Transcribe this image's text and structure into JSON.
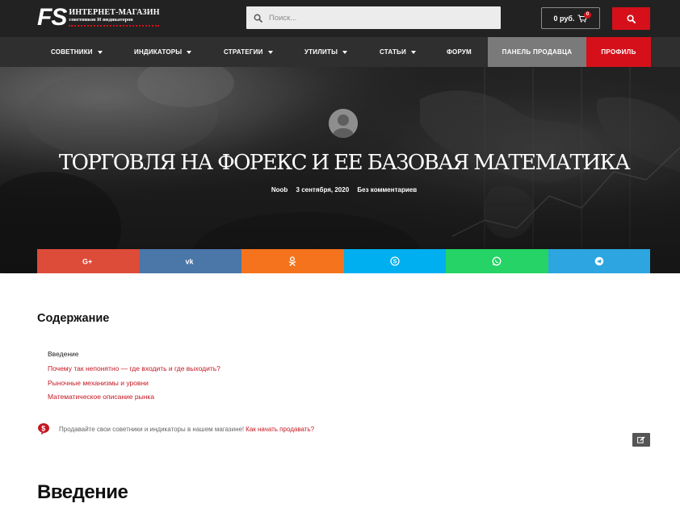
{
  "header": {
    "logo_mark": "FS",
    "logo_line1": "ИНТЕРНЕТ-МАГАЗИН",
    "logo_line2": "советников И индикаторов",
    "search_placeholder": "Поиск...",
    "cart_amount": "0 руб.",
    "cart_count": "0"
  },
  "nav": {
    "items": [
      {
        "label": "СОВЕТНИКИ",
        "dropdown": true
      },
      {
        "label": "ИНДИКАТОРЫ",
        "dropdown": true
      },
      {
        "label": "СТРАТЕГИИ",
        "dropdown": true
      },
      {
        "label": "УТИЛИТЫ",
        "dropdown": true
      },
      {
        "label": "СТАТЬИ",
        "dropdown": true
      },
      {
        "label": "ФОРУМ",
        "dropdown": false
      }
    ],
    "seller_panel": "ПАНЕЛЬ ПРОДАВЦА",
    "profile": "ПРОФИЛЬ"
  },
  "hero": {
    "title": "ТОРГОВЛЯ НА ФОРЕКС И ЕЕ БАЗОВАЯ МАТЕМАТИКА",
    "author": "Noob",
    "date": "3 сентября, 2020",
    "comments": "Без комментариев"
  },
  "share": [
    {
      "network": "google-plus",
      "color": "#dd4b39",
      "glyph": "G+"
    },
    {
      "network": "vk",
      "color": "#4a76a8",
      "glyph": "VK"
    },
    {
      "network": "odnoklassniki",
      "color": "#f4731c",
      "glyph": "ok"
    },
    {
      "network": "skype",
      "color": "#00aff0",
      "glyph": "S"
    },
    {
      "network": "whatsapp",
      "color": "#25d366",
      "glyph": "wa"
    },
    {
      "network": "telegram",
      "color": "#2ca5e0",
      "glyph": "tg"
    }
  ],
  "toc": {
    "title": "Содержание",
    "items": [
      "Введение",
      "Почему так непонятно — где входить и где выходить?",
      "Рыночные механизмы и уровни",
      "Математическое описание рынка"
    ]
  },
  "promo": {
    "text": "Продавайте свои советники и индикаторы в нашем магазине!",
    "link": "Как начать продавать?"
  },
  "section": {
    "title": "Введение"
  },
  "colors": {
    "accent": "#d5101a",
    "topbar": "#222222",
    "nav": "#2f2f2f",
    "seller_panel": "#7a7a7a"
  }
}
